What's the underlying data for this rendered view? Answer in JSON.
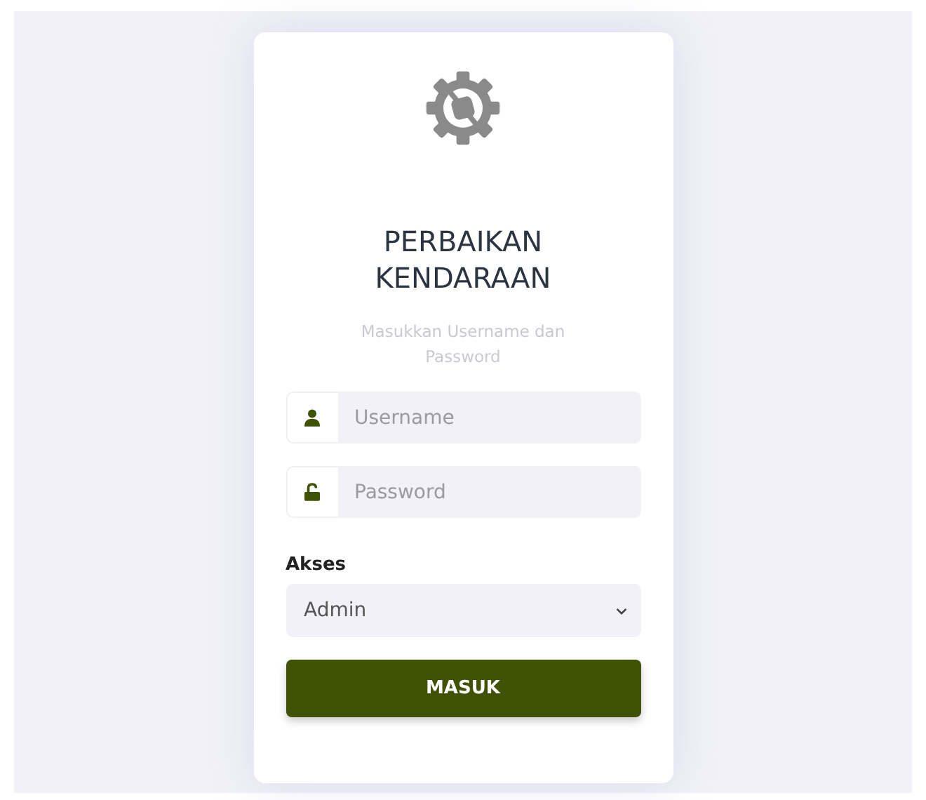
{
  "card": {
    "title": "PERBAIKAN KENDARAAN",
    "subtitle": "Masukkan Username dan Password",
    "fields": [
      {
        "kind": "user",
        "placeholder": "Username"
      },
      {
        "kind": "lock",
        "placeholder": "Password"
      }
    ],
    "access": {
      "label": "Akses",
      "value": "Admin"
    },
    "submit": "MASUK"
  }
}
